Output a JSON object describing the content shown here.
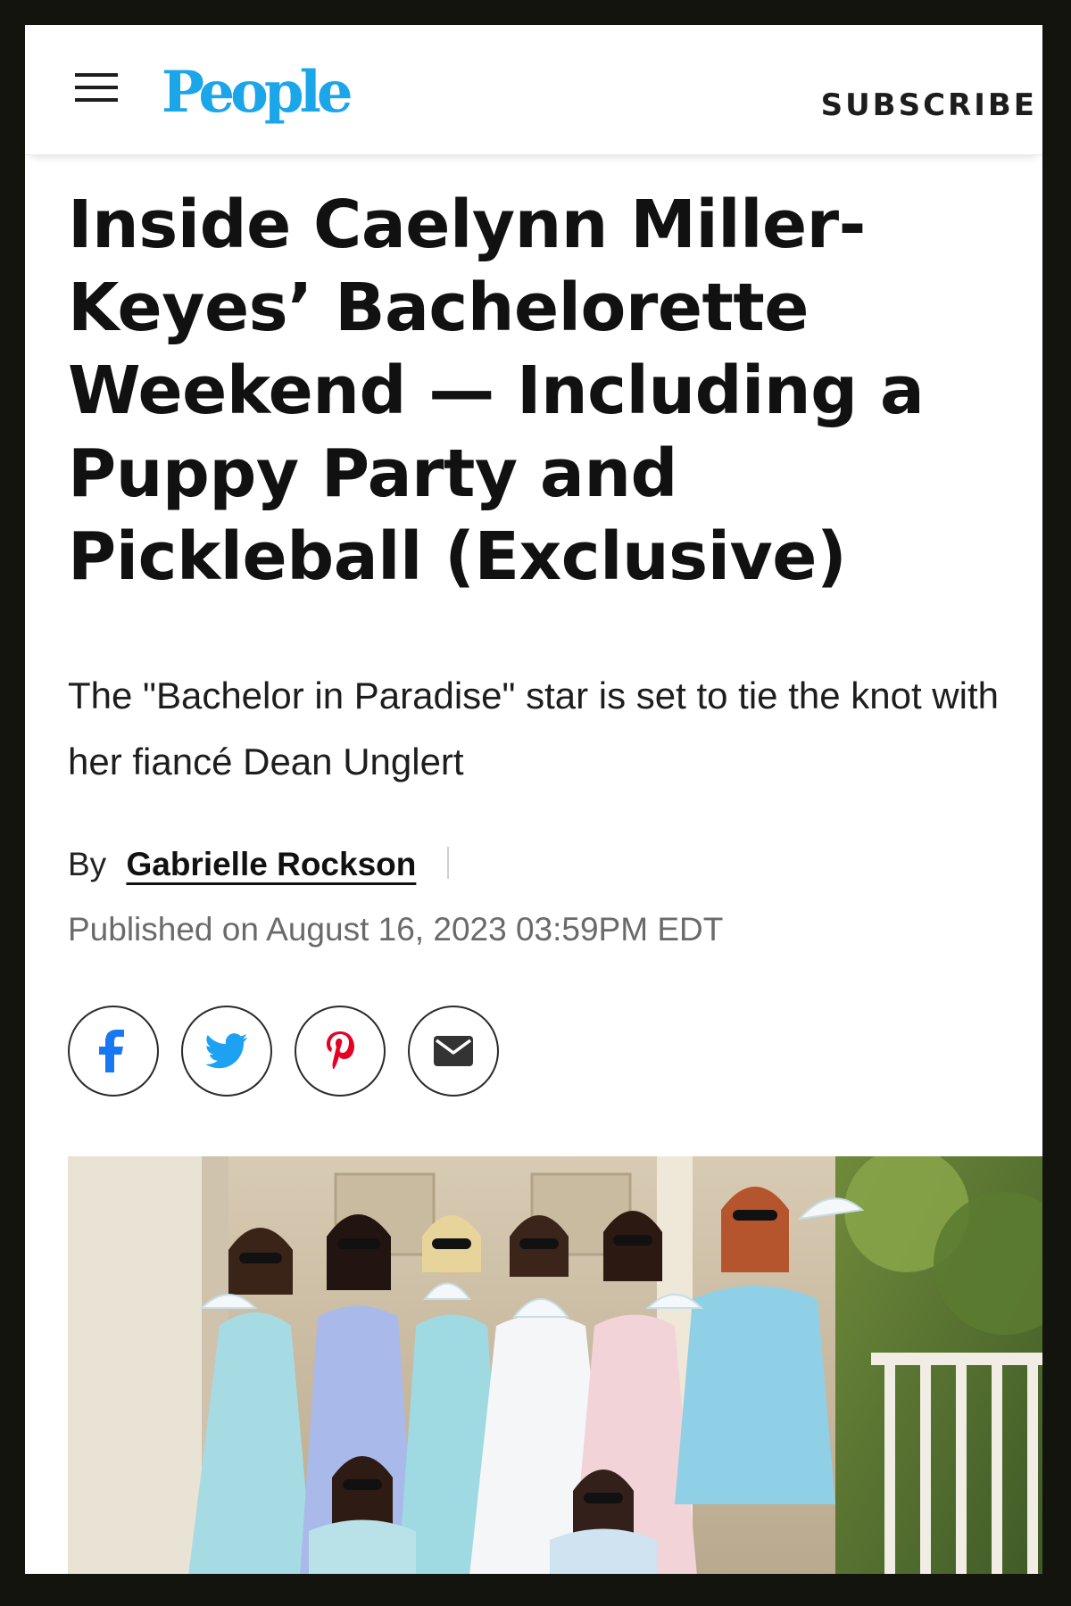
{
  "header": {
    "menu_icon": "hamburger-menu-icon",
    "logo_text": "People",
    "subscribe_label": "SUBSCRIBE"
  },
  "article": {
    "headline": "Inside Caelynn Miller-Keyes’ Bachelorette Weekend — Including a Puppy Party and Pickleball (Exclusive)",
    "dek": "The \"Bachelor in Paradise\" star is set to tie the knot with her fiancé Dean Unglert",
    "byline_prefix": "By",
    "author": "Gabrielle Rockson",
    "published": "Published on August 16, 2023 03:59PM EDT"
  },
  "share": {
    "buttons": [
      {
        "icon": "facebook-icon",
        "color": "#1877f2"
      },
      {
        "icon": "twitter-icon",
        "color": "#1da1f2"
      },
      {
        "icon": "pinterest-icon",
        "color": "#e60023"
      },
      {
        "icon": "email-icon",
        "color": "#333333"
      }
    ]
  },
  "photo": {
    "image": "group-photo-bridesmaids-in-blue-dresses"
  },
  "colors": {
    "brand": "#1aa6e8",
    "text": "#111111",
    "meta": "#6a6a6a",
    "frame": "#14140f"
  }
}
